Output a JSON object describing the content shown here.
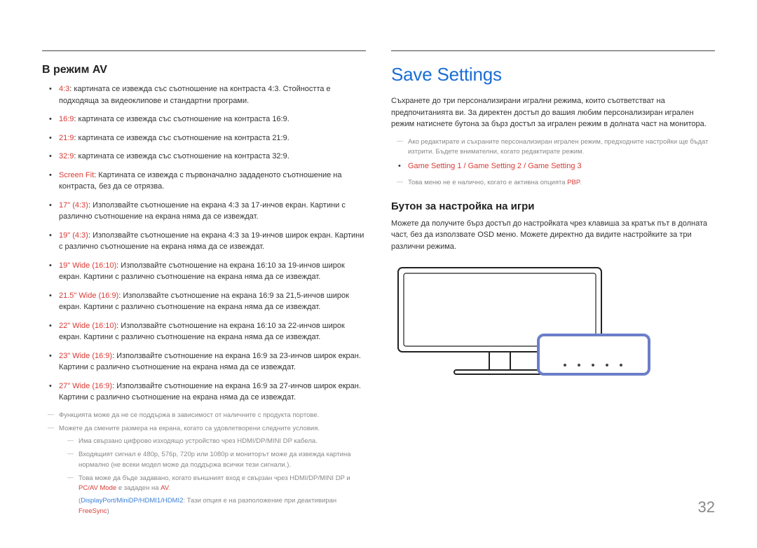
{
  "left": {
    "heading": "В режим AV",
    "items": [
      {
        "term": "4:3",
        "text": ": картината се извежда със съотношение на контраста 4:3. Стойността е подходяща за видеоклипове и стандартни програми."
      },
      {
        "term": "16:9",
        "text": ": картината се извежда със съотношение на контраста 16:9."
      },
      {
        "term": "21:9",
        "text": ": картината се извежда със съотношение на контраста 21:9."
      },
      {
        "term": "32:9",
        "text": ": картината се извежда със съотношение на контраста 32:9."
      },
      {
        "term": "Screen Fit",
        "text": ": Картината се извежда с първоначално зададеното съотношение на контраста, без да се отрязва."
      },
      {
        "term": "17\" (4:3)",
        "text": ": Използвайте съотношение на екрана 4:3 за 17-инчов екран. Картини с различно съотношение на екрана няма да се извеждат."
      },
      {
        "term": "19\" (4:3)",
        "text": ": Използвайте съотношение на екрана 4:3 за 19-инчов широк екран. Картини с различно съотношение на екрана няма да се извеждат."
      },
      {
        "term": "19\" Wide (16:10)",
        "text": ": Използвайте съотношение на екрана 16:10 за 19-инчов широк екран. Картини с различно съотношение на екрана няма да се извеждат."
      },
      {
        "term": "21.5\" Wide (16:9)",
        "text": ": Използвайте съотношение на екрана 16:9 за 21,5-инчов широк екран. Картини с различно съотношение на екрана няма да се извеждат."
      },
      {
        "term": "22\" Wide (16:10)",
        "text": ": Използвайте съотношение на екрана 16:10 за 22-инчов широк екран. Картини с различно съотношение на екрана няма да се извеждат."
      },
      {
        "term": "23\" Wide (16:9)",
        "text": ": Използвайте съотношение на екрана 16:9 за 23-инчов широк екран. Картини с различно съотношение на екрана няма да се извеждат."
      },
      {
        "term": "27\" Wide (16:9)",
        "text": ": Използвайте съотношение на екрана 16:9 за 27-инчов широк екран. Картини с различно съотношение на екрана няма да се извеждат."
      }
    ],
    "footnotes": [
      "Функцията може да не се поддържа в зависимост от наличните с продукта портове.",
      "Можете да смените размера на екрана, когато са удовлетворени следните условия."
    ],
    "footnotes_nested": [
      "Има свързано цифрово изходящо устройство чрез HDMI/DP/MINI DP кабела.",
      "Входящият сигнал е 480p, 576p, 720p или 1080p и мониторът може да извежда картина нормално (не всеки модел може да поддържа всички тези сигнали.)."
    ],
    "footnote_mode_pre": "Това може да бъде задавано, когато външният вход е свързан чрез HDMI/DP/MINI DP и ",
    "footnote_mode_term": "PC/AV Mode",
    "footnote_mode_mid": " е зададен на ",
    "footnote_mode_av": "AV",
    "footnote_mode_post": ".",
    "footnote_ports_pre": "(",
    "footnote_ports_list": "DisplayPort/MiniDP/HDMI1/HDMI2",
    "footnote_ports_mid": ": Тази опция е на разположение при деактивиран ",
    "footnote_ports_term": "FreeSync",
    "footnote_ports_post": ")"
  },
  "right": {
    "title": "Save Settings",
    "intro": "Съхранете до три персонализирани игрални режима, които съответстват на предпочитанията ви. За директен достъп до вашия любим персонализиран игрален режим натиснете бутона за бърз достъп за игрален режим в долната част на монитора.",
    "note1": "Ако редактирате и съхраните персонализиран игрален режим, предходните настройки ще бъдат изтрити. Бъдете внимателни, когато редактирате режим.",
    "settings_list": "Game Setting 1 / Game Setting 2 / Game Setting 3",
    "note2_pre": "Това меню не е налично, когато е активна опцията ",
    "note2_term": "PBP",
    "note2_post": ".",
    "sub_heading": "Бутон за настройка на игри",
    "sub_text": "Можете да получите бърз достъп до настройката чрез клавиша за кратък път в долната част, без да използвате OSD меню. Можете директно да видите настройките за три различни режима."
  },
  "page_number": "32"
}
